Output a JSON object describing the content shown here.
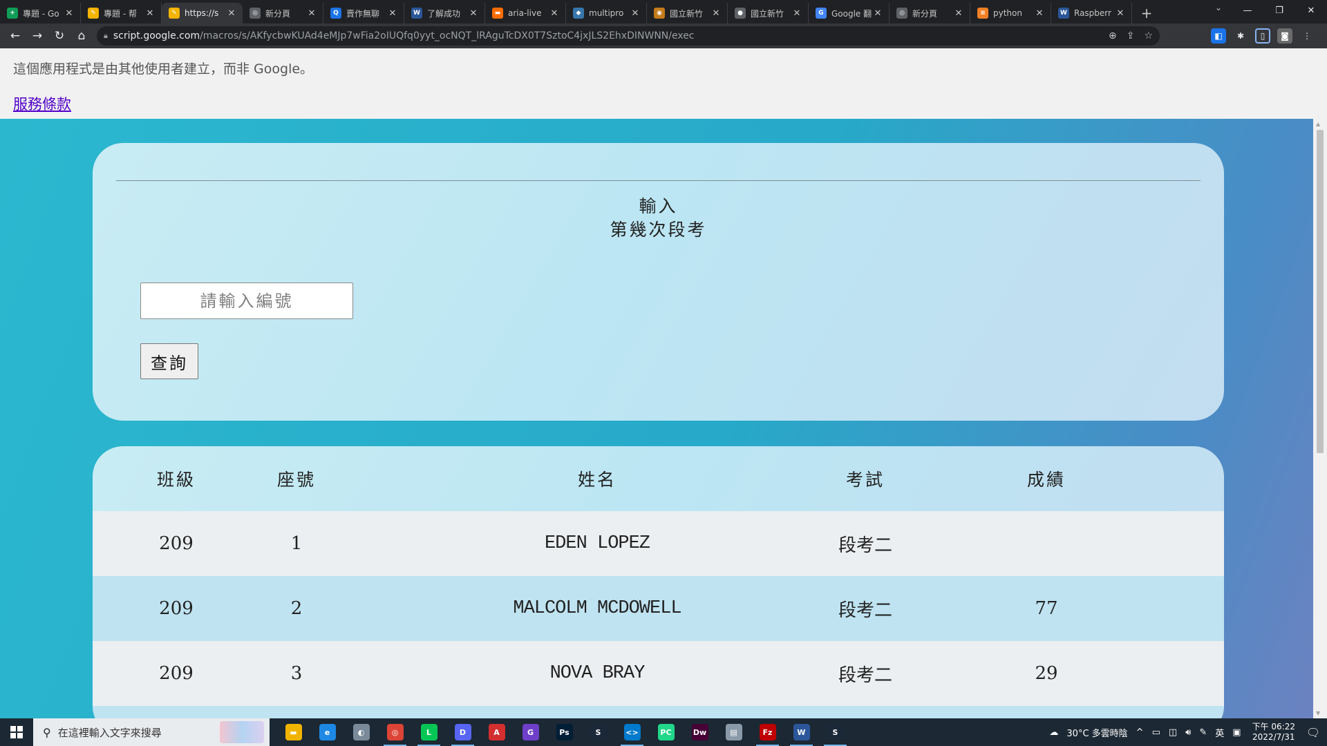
{
  "browser": {
    "tabs": [
      {
        "title": "專題 - Go",
        "icon": "sheets-icon",
        "color": "#0f9d58",
        "glyph": "+",
        "active": false
      },
      {
        "title": "專題 - 帮",
        "icon": "apps-script-icon",
        "color": "#f4b400",
        "glyph": "✎",
        "active": false
      },
      {
        "title": "https://s",
        "icon": "apps-script-icon",
        "color": "#f4b400",
        "glyph": "✎",
        "active": true
      },
      {
        "title": "新分頁",
        "icon": "chrome-icon",
        "color": "#5f6368",
        "glyph": "◎",
        "active": false
      },
      {
        "title": "賣作無聊",
        "icon": "web-icon",
        "color": "#1a73e8",
        "glyph": "Q",
        "active": false
      },
      {
        "title": "了解成功",
        "icon": "word-icon",
        "color": "#2b579a",
        "glyph": "W",
        "active": false
      },
      {
        "title": "aria-live",
        "icon": "mdn-icon",
        "color": "#ff6d00",
        "glyph": "▬",
        "active": false
      },
      {
        "title": "multipro",
        "icon": "python-icon",
        "color": "#3776ab",
        "glyph": "◆",
        "active": false
      },
      {
        "title": "國立新竹",
        "icon": "school-icon",
        "color": "#c47b1a",
        "glyph": "◉",
        "active": false
      },
      {
        "title": "國立新竹",
        "icon": "github-icon",
        "color": "#5f6368",
        "glyph": "●",
        "active": false
      },
      {
        "title": "Google 翻",
        "icon": "translate-icon",
        "color": "#4285f4",
        "glyph": "G",
        "active": false
      },
      {
        "title": "新分頁",
        "icon": "chrome-icon",
        "color": "#5f6368",
        "glyph": "◎",
        "active": false
      },
      {
        "title": "python",
        "icon": "stackoverflow-icon",
        "color": "#f48024",
        "glyph": "≡",
        "active": false
      },
      {
        "title": "Raspberr",
        "icon": "word-icon",
        "color": "#2b579a",
        "glyph": "W",
        "active": false
      }
    ],
    "url_host": "script.google.com",
    "url_path": "/macros/s/AKfycbwKUAd4eMJp7wFia2oIUQfq0yyt_ocNQT_lRAguTcDX0T7SztoC4jxJLS2EhxDINWNN/exec"
  },
  "page": {
    "notice": "這個應用程式是由其他使用者建立，而非 Google。",
    "terms_link": "服務條款",
    "query": {
      "title_line1": "輸入",
      "title_line2": "第幾次段考",
      "input_placeholder": "請輸入編號",
      "input_value": "",
      "button_label": "查詢"
    },
    "table": {
      "headers": [
        "班級",
        "座號",
        "姓名",
        "考試",
        "成績"
      ],
      "rows": [
        {
          "class": "209",
          "seat": "1",
          "name": "EDEN LOPEZ",
          "exam": "段考二",
          "score": ""
        },
        {
          "class": "209",
          "seat": "2",
          "name": "MALCOLM MCDOWELL",
          "exam": "段考二",
          "score": "77"
        },
        {
          "class": "209",
          "seat": "3",
          "name": "NOVA BRAY",
          "exam": "段考二",
          "score": "29"
        },
        {
          "class": "",
          "seat": "",
          "name": "",
          "exam": "",
          "score": ""
        }
      ]
    }
  },
  "taskbar": {
    "search_placeholder": "在這裡輸入文字來搜尋",
    "apps": [
      {
        "name": "file-explorer-icon",
        "color": "#f0b400",
        "glyph": "▬",
        "running": false
      },
      {
        "name": "edge-icon",
        "color": "#1e88e5",
        "glyph": "e",
        "running": false
      },
      {
        "name": "app-icon",
        "color": "#7a8a99",
        "glyph": "◐",
        "running": false
      },
      {
        "name": "chrome-icon",
        "color": "#db4437",
        "glyph": "◎",
        "running": true
      },
      {
        "name": "line-icon",
        "color": "#06c755",
        "glyph": "L",
        "running": true
      },
      {
        "name": "discord-icon",
        "color": "#5865f2",
        "glyph": "D",
        "running": true
      },
      {
        "name": "acrobat-icon",
        "color": "#d32f2f",
        "glyph": "A",
        "running": false
      },
      {
        "name": "github-desktop-icon",
        "color": "#6e40c9",
        "glyph": "G",
        "running": false
      },
      {
        "name": "photoshop-icon",
        "color": "#001e36",
        "glyph": "Ps",
        "running": false
      },
      {
        "name": "steam-icon",
        "color": "#1b2838",
        "glyph": "S",
        "running": false
      },
      {
        "name": "vscode-icon",
        "color": "#007acc",
        "glyph": "<>",
        "running": true
      },
      {
        "name": "pycharm-icon",
        "color": "#21d789",
        "glyph": "PC",
        "running": false
      },
      {
        "name": "dreamweaver-icon",
        "color": "#470137",
        "glyph": "Dw",
        "running": false
      },
      {
        "name": "printer-icon",
        "color": "#8a9aa8",
        "glyph": "▤",
        "running": false
      },
      {
        "name": "filezilla-icon",
        "color": "#bf0000",
        "glyph": "Fz",
        "running": true
      },
      {
        "name": "word-icon",
        "color": "#2b579a",
        "glyph": "W",
        "running": true
      },
      {
        "name": "steam-running-icon",
        "color": "#1b2838",
        "glyph": "S",
        "running": true
      }
    ],
    "weather": "30°C 多雲時陰",
    "ime": "英",
    "time": "下午 06:22",
    "date": "2022/7/31"
  }
}
